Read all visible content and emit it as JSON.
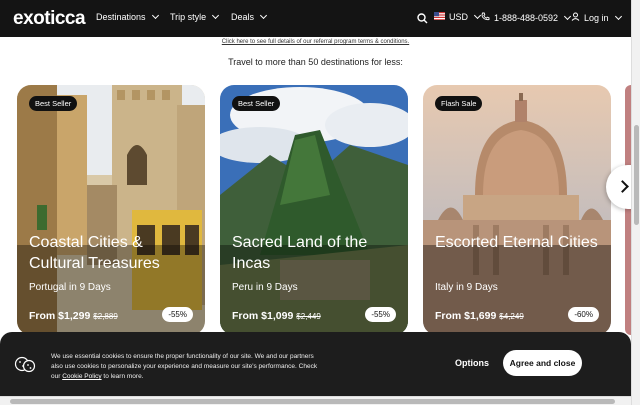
{
  "nav": {
    "logo": "exoticca",
    "items": [
      {
        "label": "Destinations"
      },
      {
        "label": "Trip style"
      },
      {
        "label": "Deals"
      }
    ],
    "currency": "USD",
    "phone": "1-888-488-0592",
    "login": "Log in"
  },
  "referral_link": "Click here to see full details of our referral program terms & conditions.",
  "tagline": "Travel to more than 50 destinations for less:",
  "cards": [
    {
      "badge": "Best Seller",
      "title": "Coastal Cities & Cultural Treasures",
      "subtitle": "Portugal in 9 Days",
      "price": "From $1,299",
      "old_price": "$2,889",
      "discount": "-55%"
    },
    {
      "badge": "Best Seller",
      "title": "Sacred Land of the Incas",
      "subtitle": "Peru in 9 Days",
      "price": "From $1,099",
      "old_price": "$2,449",
      "discount": "-55%"
    },
    {
      "badge": "Flash Sale",
      "title": "Escorted Eternal Cities",
      "subtitle": "Italy in 9 Days",
      "price": "From $1,699",
      "old_price": "$4,249",
      "discount": "-60%"
    }
  ],
  "cookie": {
    "text_before": "We use essential cookies to ensure the proper functionality of our site. We and our partners also use cookies to personalize your experience and measure our site's performance. Check our ",
    "policy_link": "Cookie Policy",
    "text_after": " to learn more.",
    "options_label": "Options",
    "agree_label": "Agree and close"
  },
  "colors": {
    "nav_bg": "#141414",
    "cookie_bg": "#1d1d1d"
  }
}
